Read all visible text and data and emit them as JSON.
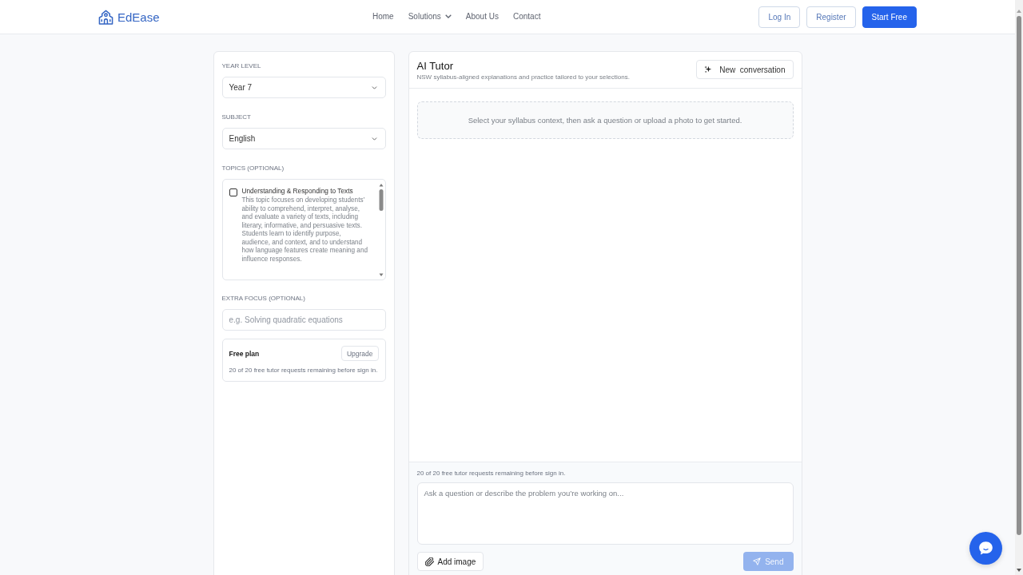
{
  "header": {
    "logo": "EdEase",
    "nav": [
      {
        "label": "Home",
        "dropdown": false
      },
      {
        "label": "Solutions",
        "dropdown": true
      },
      {
        "label": "About Us",
        "dropdown": false
      },
      {
        "label": "Contact",
        "dropdown": false
      }
    ],
    "buttons": [
      {
        "label": "Log In",
        "kind": "outline"
      },
      {
        "label": "Register",
        "kind": "outline"
      },
      {
        "label": "Start Free",
        "kind": "primary"
      }
    ]
  },
  "sidebar": {
    "year_level": {
      "label": "YEAR LEVEL",
      "value": "Year 7"
    },
    "subject": {
      "label": "SUBJECT",
      "value": "English"
    },
    "topics": {
      "label": "TOPICS (OPTIONAL)",
      "items": [
        {
          "title": "Understanding & Responding to Texts",
          "description": "This topic focuses on developing students’ ability to comprehend, interpret, analyse, and evaluate a variety of texts, including literary, informative, and persuasive texts. Students learn to identify purpose, audience, and context, and to understand how language features create meaning and influence responses.",
          "checked": false
        }
      ]
    },
    "extra_focus": {
      "label": "EXTRA FOCUS (OPTIONAL)",
      "placeholder": "e.g. Solving quadratic equations"
    },
    "plan": {
      "title": "Free plan",
      "button": "Upgrade",
      "note": "20 of 20 free tutor requests remaining before sign in."
    }
  },
  "tutor": {
    "title": "AI Tutor",
    "subtitle": "NSW syllabus-aligned explanations and practice tailored to your selections.",
    "new_button": "New  conversation",
    "empty_message": "Select your syllabus context, then ask a question or upload a photo to get started.",
    "quota_note": "20 of 20 free tutor requests remaining before sign in.",
    "input": {
      "placeholder": "Ask a question or describe the problem you’re working on..."
    },
    "add_image_button": "Add image",
    "send_button": {
      "label": "Send",
      "disabled": true
    }
  }
}
